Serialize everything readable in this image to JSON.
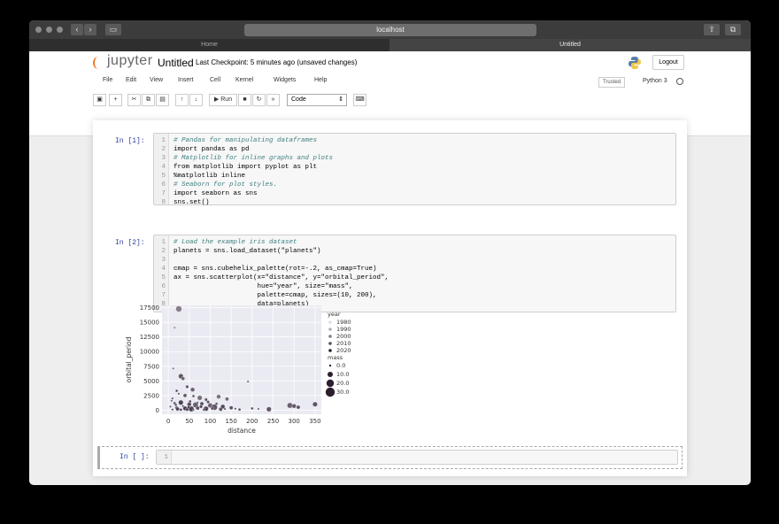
{
  "browser": {
    "url": "localhost",
    "tabs": [
      "Home",
      "Untitled"
    ]
  },
  "header": {
    "logo_text": "jupyter",
    "notebook_title": "Untitled",
    "checkpoint": "Last Checkpoint: 5 minutes ago",
    "save_status": "(unsaved changes)",
    "logout": "Logout",
    "trusted": "Trusted",
    "kernel": "Python 3"
  },
  "menu": [
    "File",
    "Edit",
    "View",
    "Insert",
    "Cell",
    "Kernel",
    "Widgets",
    "Help"
  ],
  "toolbar": {
    "run": "Run",
    "cell_type": "Code"
  },
  "cells": [
    {
      "prompt": "In [1]:",
      "lines": [
        {
          "n": "1",
          "text": "# Pandas for manipulating dataframes",
          "kind": "cm"
        },
        {
          "n": "2",
          "text": "import pandas as pd",
          "kind": "code"
        },
        {
          "n": "3",
          "text": "# Matplotlib for inline graphs and plots",
          "kind": "cm"
        },
        {
          "n": "4",
          "text": "from matplotlib import pyplot as plt",
          "kind": "code"
        },
        {
          "n": "5",
          "text": "%matplotlib inline",
          "kind": "code"
        },
        {
          "n": "6",
          "text": "# Seaborn for plot styles.",
          "kind": "cm"
        },
        {
          "n": "7",
          "text": "import seaborn as sns",
          "kind": "code"
        },
        {
          "n": "8",
          "text": "sns.set()",
          "kind": "code"
        }
      ]
    },
    {
      "prompt": "In [2]:",
      "lines": [
        {
          "n": "1",
          "text": "# Load the example iris dataset",
          "kind": "cm"
        },
        {
          "n": "2",
          "text": "planets = sns.load_dataset(\"planets\")",
          "kind": "code"
        },
        {
          "n": "3",
          "text": "",
          "kind": "code"
        },
        {
          "n": "4",
          "text": "cmap = sns.cubehelix_palette(rot=-.2, as_cmap=True)",
          "kind": "code"
        },
        {
          "n": "5",
          "text": "ax = sns.scatterplot(x=\"distance\", y=\"orbital_period\",",
          "kind": "code"
        },
        {
          "n": "6",
          "text": "                     hue=\"year\", size=\"mass\",",
          "kind": "code"
        },
        {
          "n": "7",
          "text": "                     palette=cmap, sizes=(10, 200),",
          "kind": "code"
        },
        {
          "n": "8",
          "text": "                     data=planets)",
          "kind": "code"
        }
      ]
    },
    {
      "prompt": "In [ ]:",
      "lines": [
        {
          "n": "1",
          "text": "",
          "kind": "code"
        }
      ]
    }
  ],
  "chart_data": {
    "type": "scatter",
    "xlabel": "distance",
    "ylabel": "orbital_period",
    "xlim": [
      -15,
      365
    ],
    "ylim": [
      -700,
      17900
    ],
    "xticks": [
      0,
      50,
      100,
      150,
      200,
      250,
      300,
      350
    ],
    "yticks": [
      0,
      2500,
      5000,
      7500,
      10000,
      12500,
      15000,
      17500
    ],
    "grid": true,
    "legend_position": "right",
    "legend": {
      "hue_title": "year",
      "hue_entries": [
        "1980",
        "1990",
        "2000",
        "2010",
        "2020"
      ],
      "size_title": "mass",
      "size_entries": [
        "0.0",
        "10.0",
        "20.0",
        "30.0"
      ]
    },
    "points": [
      {
        "x": 25,
        "y": 17300,
        "m": 8,
        "yr": 2000
      },
      {
        "x": 15,
        "y": 14100,
        "m": 2,
        "yr": 1992
      },
      {
        "x": 12,
        "y": 7100,
        "m": 1,
        "yr": 2005
      },
      {
        "x": 30,
        "y": 5800,
        "m": 6,
        "yr": 2008
      },
      {
        "x": 35,
        "y": 5400,
        "m": 4,
        "yr": 2004
      },
      {
        "x": 45,
        "y": 4000,
        "m": 3,
        "yr": 2009
      },
      {
        "x": 58,
        "y": 3500,
        "m": 5,
        "yr": 2006
      },
      {
        "x": 20,
        "y": 3300,
        "m": 2,
        "yr": 2011
      },
      {
        "x": 25,
        "y": 2800,
        "m": 1,
        "yr": 2012
      },
      {
        "x": 40,
        "y": 2500,
        "m": 4,
        "yr": 2007
      },
      {
        "x": 60,
        "y": 2400,
        "m": 2,
        "yr": 2010
      },
      {
        "x": 75,
        "y": 2100,
        "m": 6,
        "yr": 2003
      },
      {
        "x": 10,
        "y": 2000,
        "m": 1,
        "yr": 2013
      },
      {
        "x": 90,
        "y": 1800,
        "m": 3,
        "yr": 2008
      },
      {
        "x": 120,
        "y": 2300,
        "m": 5,
        "yr": 2002
      },
      {
        "x": 140,
        "y": 1900,
        "m": 4,
        "yr": 2004
      },
      {
        "x": 190,
        "y": 4900,
        "m": 1,
        "yr": 2010
      },
      {
        "x": 15,
        "y": 1200,
        "m": 2,
        "yr": 2011
      },
      {
        "x": 30,
        "y": 1300,
        "m": 6,
        "yr": 2012
      },
      {
        "x": 50,
        "y": 1000,
        "m": 5,
        "yr": 2009
      },
      {
        "x": 65,
        "y": 900,
        "m": 7,
        "yr": 2006
      },
      {
        "x": 80,
        "y": 1100,
        "m": 4,
        "yr": 2010
      },
      {
        "x": 100,
        "y": 800,
        "m": 6,
        "yr": 2005
      },
      {
        "x": 110,
        "y": 500,
        "m": 8,
        "yr": 2008
      },
      {
        "x": 130,
        "y": 600,
        "m": 5,
        "yr": 2011
      },
      {
        "x": 150,
        "y": 400,
        "m": 4,
        "yr": 2009
      },
      {
        "x": 20,
        "y": 400,
        "m": 3,
        "yr": 2014
      },
      {
        "x": 40,
        "y": 300,
        "m": 5,
        "yr": 2013
      },
      {
        "x": 55,
        "y": 200,
        "m": 7,
        "yr": 2012
      },
      {
        "x": 70,
        "y": 350,
        "m": 4,
        "yr": 2010
      },
      {
        "x": 90,
        "y": 250,
        "m": 6,
        "yr": 2011
      },
      {
        "x": 105,
        "y": 300,
        "m": 3,
        "yr": 2009
      },
      {
        "x": 10,
        "y": 100,
        "m": 1,
        "yr": 2014
      },
      {
        "x": 30,
        "y": 80,
        "m": 2,
        "yr": 2013
      },
      {
        "x": 45,
        "y": 120,
        "m": 3,
        "yr": 2012
      },
      {
        "x": 60,
        "y": 60,
        "m": 1,
        "yr": 2011
      },
      {
        "x": 85,
        "y": 90,
        "m": 2,
        "yr": 2010
      },
      {
        "x": 125,
        "y": 150,
        "m": 4,
        "yr": 2009
      },
      {
        "x": 160,
        "y": 250,
        "m": 1,
        "yr": 2012
      },
      {
        "x": 170,
        "y": 100,
        "m": 2,
        "yr": 2011
      },
      {
        "x": 200,
        "y": 300,
        "m": 2,
        "yr": 2010
      },
      {
        "x": 215,
        "y": 200,
        "m": 1,
        "yr": 2011
      },
      {
        "x": 240,
        "y": 150,
        "m": 6,
        "yr": 2008
      },
      {
        "x": 290,
        "y": 800,
        "m": 7,
        "yr": 2006
      },
      {
        "x": 300,
        "y": 700,
        "m": 5,
        "yr": 2007
      },
      {
        "x": 310,
        "y": 500,
        "m": 4,
        "yr": 2009
      },
      {
        "x": 350,
        "y": 1000,
        "m": 6,
        "yr": 2008
      },
      {
        "x": 5,
        "y": 600,
        "m": 1,
        "yr": 2012
      },
      {
        "x": 18,
        "y": 900,
        "m": 2,
        "yr": 2010
      },
      {
        "x": 35,
        "y": 700,
        "m": 1,
        "yr": 2013
      },
      {
        "x": 8,
        "y": 1600,
        "m": 1,
        "yr": 2009
      },
      {
        "x": 52,
        "y": 1500,
        "m": 2,
        "yr": 2011
      },
      {
        "x": 70,
        "y": 1300,
        "m": 1,
        "yr": 2012
      },
      {
        "x": 95,
        "y": 1400,
        "m": 3,
        "yr": 2007
      },
      {
        "x": 22,
        "y": 200,
        "m": 4,
        "yr": 2012
      },
      {
        "x": 48,
        "y": 500,
        "m": 2,
        "yr": 2013
      },
      {
        "x": 78,
        "y": 600,
        "m": 3,
        "yr": 2011
      },
      {
        "x": 115,
        "y": 1100,
        "m": 2,
        "yr": 2010
      },
      {
        "x": 135,
        "y": 200,
        "m": 1,
        "yr": 2014
      }
    ]
  }
}
